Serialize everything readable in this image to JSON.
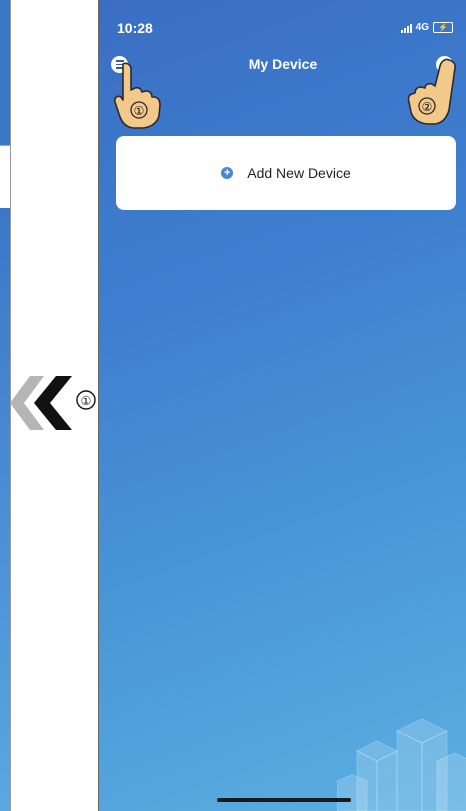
{
  "status_bar": {
    "time": "10:28",
    "network": "4G"
  },
  "nav": {
    "title": "My Device"
  },
  "add_card": {
    "label": "Add New Device"
  },
  "annotations": {
    "step_one": "①",
    "step_two": "②",
    "arrow_step": "①"
  },
  "colors": {
    "accent": "#3e7fd0",
    "card": "#ffffff",
    "plus_icon": "#4a86d6"
  },
  "icons": [
    "menu-icon",
    "plus-icon",
    "hand-pointer-icon",
    "double-chevron-left-icon",
    "signal-icon",
    "battery-charging-icon"
  ]
}
